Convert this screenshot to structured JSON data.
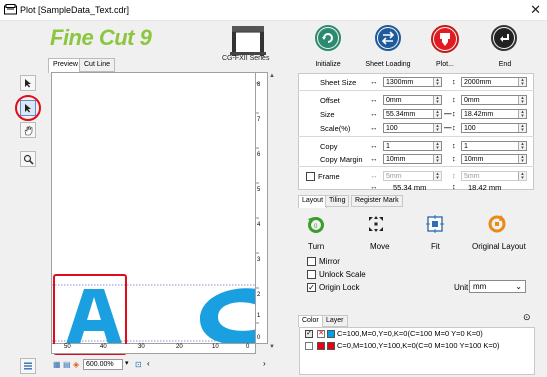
{
  "window": {
    "title": "Plot [SampleData_Text.cdr]",
    "close_glyph": "✕"
  },
  "brand": {
    "logo_text": "Fine Cut 9",
    "logo_color": "#8cc63e",
    "printer_model": "CG-FXII Series"
  },
  "preview": {
    "tabs": [
      "Preview",
      "Cut Line"
    ],
    "active_tab": "Preview",
    "letters": [
      "A",
      "C"
    ],
    "letter_color": "#1a9fe0",
    "vertical_ruler": [
      "0",
      "1",
      "2",
      "3",
      "4",
      "5",
      "6",
      "7",
      "8"
    ],
    "horizontal_ruler": [
      "50",
      "40",
      "30",
      "20",
      "10",
      "0"
    ],
    "zoom": "600.00%"
  },
  "tools": [
    "select-arrow-icon",
    "node-edit-icon",
    "hand-pan-icon",
    "zoom-magnifier-icon"
  ],
  "toolbar": {
    "buttons": [
      {
        "label": "Initialize",
        "icon": "reload-icon"
      },
      {
        "label": "Sheet Loading",
        "icon": "sheet-loading-icon"
      },
      {
        "label": "Plot...",
        "icon": "plot-icon"
      },
      {
        "label": "End",
        "icon": "return-icon"
      }
    ]
  },
  "settings": {
    "sheet_size": {
      "label": "Sheet Size",
      "width": "1300mm",
      "height": "2000mm"
    },
    "offset": {
      "label": "Offset",
      "x": "0mm",
      "y": "0mm"
    },
    "size": {
      "label": "Size",
      "x": "55.34mm",
      "y": "18.42mm"
    },
    "scale": {
      "label": "Scale(%)",
      "x": "100",
      "y": "100"
    },
    "copy": {
      "label": "Copy",
      "x": "1",
      "y": "1"
    },
    "copy_margin": {
      "label": "Copy Margin",
      "x": "10mm",
      "y": "10mm"
    },
    "frame": {
      "label": "Frame",
      "x": "5mm",
      "y": "5mm",
      "total_x": "55.34 mm",
      "total_y": "18.42 mm"
    }
  },
  "layout_tabs": [
    "Layout",
    "Tiling",
    "Register Mark"
  ],
  "layout_actions": [
    {
      "label": "Turn",
      "icon": "turn-icon"
    },
    {
      "label": "Move",
      "icon": "move-icon"
    },
    {
      "label": "Fit",
      "icon": "fit-icon"
    },
    {
      "label": "Original Layout",
      "icon": "original-layout-icon"
    }
  ],
  "options": {
    "mirror": {
      "label": "Mirror",
      "checked": false
    },
    "unlock_scale": {
      "label": "Unlock Scale",
      "checked": false
    },
    "origin_lock": {
      "label": "Origin Lock",
      "checked": true
    },
    "unit_label": "Unit:",
    "unit_value": "mm"
  },
  "layer_tabs": [
    "Color",
    "Layer"
  ],
  "layers": [
    {
      "name": "C=100,M=0,Y=0,K=0(C=100 M=0 Y=0 K=0)",
      "color": "#00a0e9",
      "checked": true
    },
    {
      "name": "C=0,M=100,Y=100,K=0(C=0 M=100 Y=100 K=0)",
      "color": "#e60012",
      "checked": false
    }
  ],
  "colors": {
    "highlight_red": "#e10b1a",
    "accent_blue": "#2f6fb5"
  }
}
